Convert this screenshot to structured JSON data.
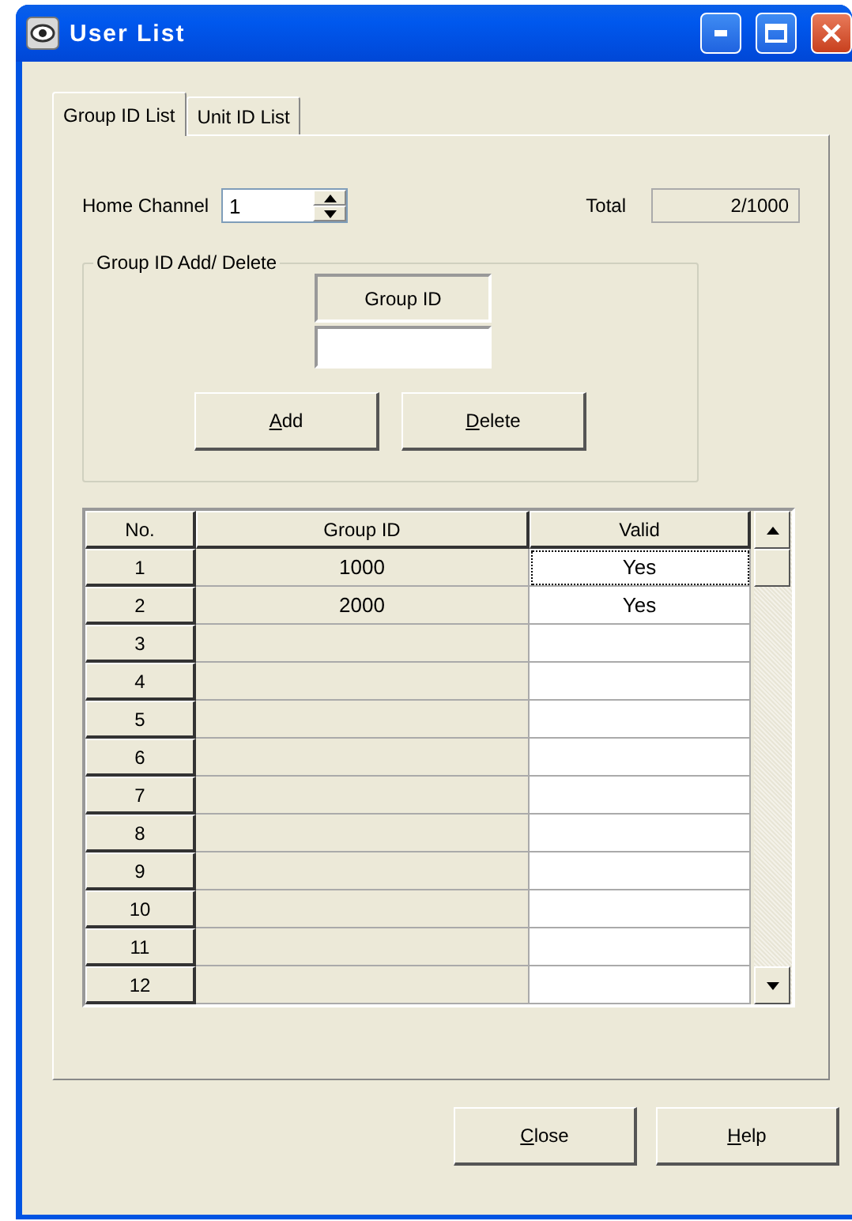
{
  "window": {
    "title": "User List"
  },
  "tabs": [
    {
      "label": "Group ID List",
      "selected": true
    },
    {
      "label": "Unit ID List",
      "selected": false
    }
  ],
  "home_channel": {
    "label": "Home Channel",
    "value": "1"
  },
  "total": {
    "label": "Total",
    "value": "2/1000"
  },
  "group_box": {
    "title": "Group ID Add/ Delete",
    "field_label": "Group ID",
    "buttons": [
      "Add",
      "Delete"
    ]
  },
  "table": {
    "columns": [
      "No.",
      "Group ID",
      "Valid"
    ],
    "rows": [
      {
        "no": "1",
        "group_id": "1000",
        "valid": "Yes",
        "focused": true
      },
      {
        "no": "2",
        "group_id": "2000",
        "valid": "Yes",
        "focused": false
      },
      {
        "no": "3",
        "focused": false
      },
      {
        "no": "4",
        "focused": false
      },
      {
        "no": "5",
        "focused": false
      },
      {
        "no": "6",
        "focused": false
      },
      {
        "no": "7",
        "focused": false
      },
      {
        "no": "8",
        "focused": false
      },
      {
        "no": "9",
        "focused": false
      },
      {
        "no": "10",
        "focused": false
      },
      {
        "no": "11",
        "focused": false
      },
      {
        "no": "12",
        "focused": false
      }
    ]
  },
  "buttons": [
    "Close",
    "Help"
  ]
}
